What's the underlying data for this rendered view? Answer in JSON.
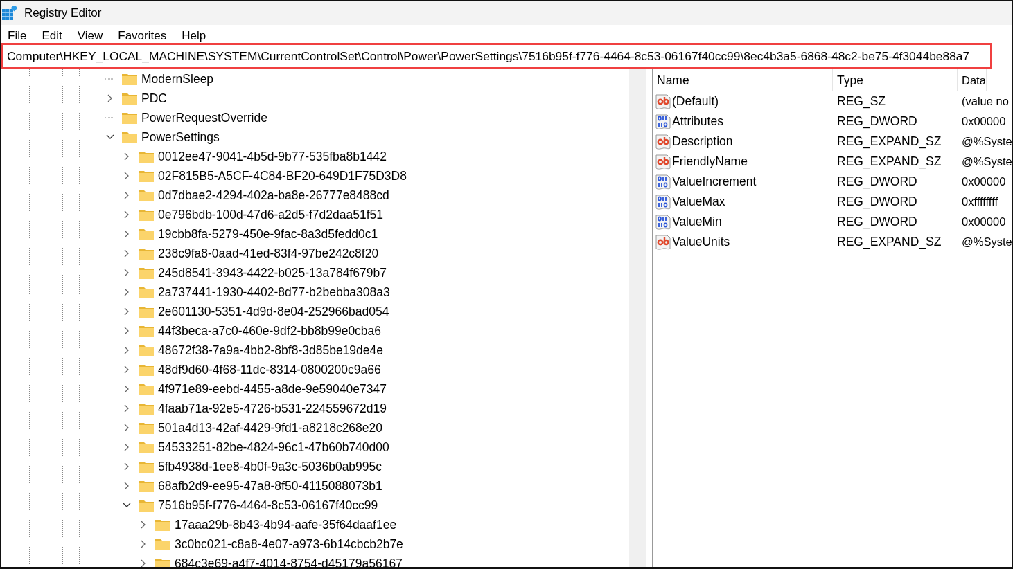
{
  "window": {
    "title": "Registry Editor"
  },
  "menu": [
    "File",
    "Edit",
    "View",
    "Favorites",
    "Help"
  ],
  "address_bar": {
    "value": "Computer\\HKEY_LOCAL_MACHINE\\SYSTEM\\CurrentControlSet\\Control\\Power\\PowerSettings\\7516b95f-f776-4464-8c53-06167f40cc99\\8ec4b3a5-6868-48c2-be75-4f3044be88a7",
    "highlighted": true
  },
  "tree": [
    {
      "label": "ModernSleep",
      "expandable": false
    },
    {
      "label": "PDC",
      "expandable": true,
      "expanded": false
    },
    {
      "label": "PowerRequestOverride",
      "expandable": false
    },
    {
      "label": "PowerSettings",
      "expandable": true,
      "expanded": true,
      "children": [
        {
          "label": "0012ee47-9041-4b5d-9b77-535fba8b1442",
          "expandable": true,
          "expanded": false
        },
        {
          "label": "02F815B5-A5CF-4C84-BF20-649D1F75D3D8",
          "expandable": true,
          "expanded": false
        },
        {
          "label": "0d7dbae2-4294-402a-ba8e-26777e8488cd",
          "expandable": true,
          "expanded": false
        },
        {
          "label": "0e796bdb-100d-47d6-a2d5-f7d2daa51f51",
          "expandable": true,
          "expanded": false
        },
        {
          "label": "19cbb8fa-5279-450e-9fac-8a3d5fedd0c1",
          "expandable": true,
          "expanded": false
        },
        {
          "label": "238c9fa8-0aad-41ed-83f4-97be242c8f20",
          "expandable": true,
          "expanded": false
        },
        {
          "label": "245d8541-3943-4422-b025-13a784f679b7",
          "expandable": true,
          "expanded": false
        },
        {
          "label": "2a737441-1930-4402-8d77-b2bebba308a3",
          "expandable": true,
          "expanded": false
        },
        {
          "label": "2e601130-5351-4d9d-8e04-252966bad054",
          "expandable": true,
          "expanded": false
        },
        {
          "label": "44f3beca-a7c0-460e-9df2-bb8b99e0cba6",
          "expandable": true,
          "expanded": false
        },
        {
          "label": "48672f38-7a9a-4bb2-8bf8-3d85be19de4e",
          "expandable": true,
          "expanded": false
        },
        {
          "label": "48df9d60-4f68-11dc-8314-0800200c9a66",
          "expandable": true,
          "expanded": false
        },
        {
          "label": "4f971e89-eebd-4455-a8de-9e59040e7347",
          "expandable": true,
          "expanded": false
        },
        {
          "label": "4faab71a-92e5-4726-b531-224559672d19",
          "expandable": true,
          "expanded": false
        },
        {
          "label": "501a4d13-42af-4429-9fd1-a8218c268e20",
          "expandable": true,
          "expanded": false
        },
        {
          "label": "54533251-82be-4824-96c1-47b60b740d00",
          "expandable": true,
          "expanded": false
        },
        {
          "label": "5fb4938d-1ee8-4b0f-9a3c-5036b0ab995c",
          "expandable": true,
          "expanded": false
        },
        {
          "label": "68afb2d9-ee95-47a8-8f50-4115088073b1",
          "expandable": true,
          "expanded": false
        },
        {
          "label": "7516b95f-f776-4464-8c53-06167f40cc99",
          "expandable": true,
          "expanded": true,
          "children": [
            {
              "label": "17aaa29b-8b43-4b94-aafe-35f64daaf1ee",
              "expandable": true,
              "expanded": false
            },
            {
              "label": "3c0bc021-c8a8-4e07-a973-6b14cbcb2b7e",
              "expandable": true,
              "expanded": false
            },
            {
              "label": "684c3e69-a4f7-4014-8754-d45179a56167",
              "expandable": true,
              "expanded": false
            }
          ]
        }
      ]
    }
  ],
  "values": {
    "columns": [
      "Name",
      "Type",
      "Data"
    ],
    "rows": [
      {
        "kind": "string",
        "name": "(Default)",
        "type": "REG_SZ",
        "data": "(value no"
      },
      {
        "kind": "binary",
        "name": "Attributes",
        "type": "REG_DWORD",
        "data": "0x00000"
      },
      {
        "kind": "string",
        "name": "Description",
        "type": "REG_EXPAND_SZ",
        "data": "@%Syste"
      },
      {
        "kind": "string",
        "name": "FriendlyName",
        "type": "REG_EXPAND_SZ",
        "data": "@%Syste"
      },
      {
        "kind": "binary",
        "name": "ValueIncrement",
        "type": "REG_DWORD",
        "data": "0x00000"
      },
      {
        "kind": "binary",
        "name": "ValueMax",
        "type": "REG_DWORD",
        "data": "0xffffffff"
      },
      {
        "kind": "binary",
        "name": "ValueMin",
        "type": "REG_DWORD",
        "data": "0x00000"
      },
      {
        "kind": "string",
        "name": "ValueUnits",
        "type": "REG_EXPAND_SZ",
        "data": "@%Syste"
      }
    ]
  }
}
